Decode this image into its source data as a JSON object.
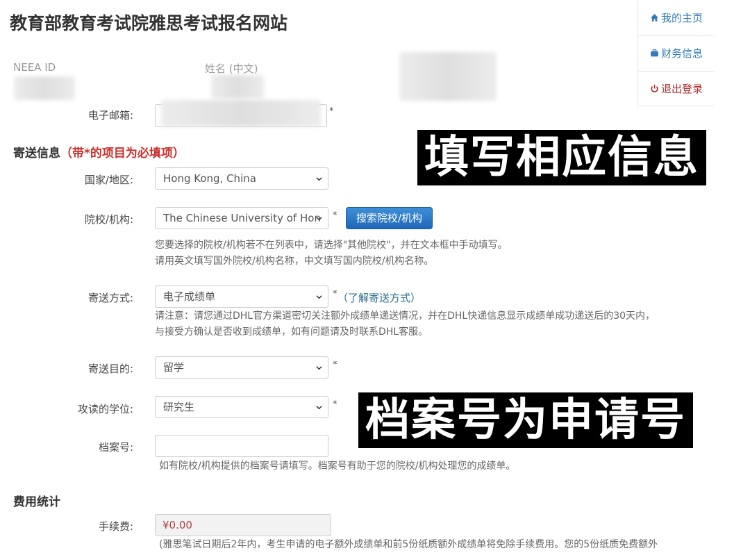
{
  "site": {
    "title": "教育部教育考试院雅思考试报名网站"
  },
  "nav": [
    {
      "label": "我的主页",
      "icon": "home-icon"
    },
    {
      "label": "财务信息",
      "icon": "briefcase-icon"
    },
    {
      "label": "退出登录",
      "icon": "power-icon"
    }
  ],
  "profile": {
    "neea_label": "NEEA ID",
    "name_label": "姓名 (中文)",
    "email_label": "电子邮箱:"
  },
  "shipping": {
    "heading": "寄送信息",
    "required_note": "（带*的项目为必填项）",
    "country_label": "国家/地区:",
    "country_value": "Hong Kong, China",
    "institution_label": "院校/机构:",
    "institution_value": "The Chinese University of Hon",
    "search_button": "搜索院校/机构",
    "institution_hint_1": "您要选择的院校/机构若不在列表中，请选择\"其他院校\"，并在文本框中手动填写。",
    "institution_hint_2": "请用英文填写国外院校/机构名称，中文填写国内院校/机构名称。",
    "method_label": "寄送方式:",
    "method_value": "电子成绩单",
    "method_link": "（了解寄送方式）",
    "method_hint_1": "请注意：请您通过DHL官方渠道密切关注额外成绩单递送情况，并在DHL快递信息显示成绩单成功递送后的30天内，",
    "method_hint_2": "与接受方确认是否收到成绩单，如有问题请及时联系DHL客服。",
    "purpose_label": "寄送目的:",
    "purpose_value": "留学",
    "degree_label": "攻读的学位:",
    "degree_value": "研究生",
    "file_label": "档案号:",
    "file_value": "",
    "file_hint": "如有院校/机构提供的档案号请填写。档案号有助于您的院校/机构处理您的成绩单。",
    "star": "*"
  },
  "fees": {
    "heading": "费用统计",
    "fee_label": "手续费:",
    "fee_value": "¥0.00",
    "fee_hint": "(雅思笔试日期后2年内，考生申请的电子额外成绩单和前5份纸质额外成绩单将免除手续费用。您的5份纸质免费额外"
  },
  "overlays": {
    "fill_info": "填写相应信息",
    "file_is_app": "档案号为申请号"
  },
  "colors": {
    "link": "#337ab7",
    "required": "#c9302c",
    "button": "#2a78c8",
    "logout": "#b02b2c"
  }
}
